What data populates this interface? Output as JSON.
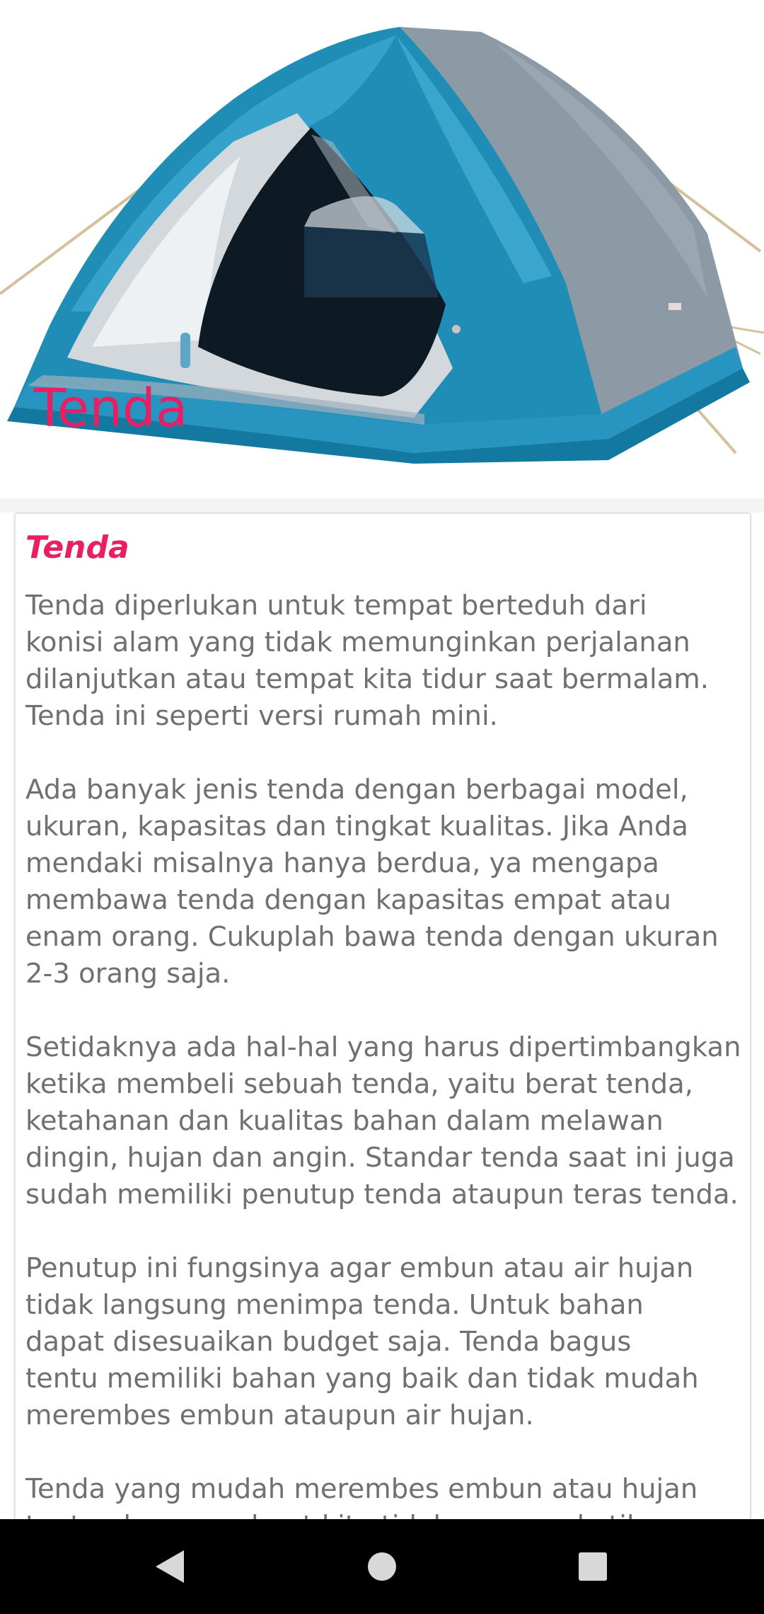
{
  "header": {
    "title": "Tenda",
    "image_icon": "tent-image"
  },
  "card": {
    "title": "Tenda",
    "paragraphs": [
      "Tenda diperlukan untuk tempat berteduh dari\nkonisi alam yang tidak memunginkan perjalanan\ndilanjutkan atau tempat kita tidur saat bermalam.\nTenda ini seperti versi rumah mini.",
      "Ada banyak jenis tenda dengan berbagai model,\nukuran, kapasitas dan tingkat kualitas. Jika Anda\nmendaki misalnya hanya berdua, ya mengapa\nmembawa tenda dengan kapasitas empat atau\nenam orang. Cukuplah bawa tenda dengan ukuran\n2-3 orang saja.",
      "Setidaknya ada hal-hal yang harus dipertimbangkan\nketika membeli sebuah tenda, yaitu berat tenda,\nketahanan dan kualitas bahan dalam melawan\ndingin, hujan dan angin. Standar tenda saat ini juga\nsudah memiliki penutup tenda ataupun teras tenda.",
      "Penutup ini fungsinya agar embun atau air hujan\ntidak langsung menimpa tenda. Untuk bahan\ndapat disesuaikan budget saja. Tenda bagus\ntentu memiliki bahan yang baik dan tidak mudah\nmerembes embun ataupun air hujan.",
      "Tenda yang mudah merembes embun atau hujan\ntentu akan membuat kita tidak nyaman ketika"
    ]
  },
  "navigation": {
    "back_icon": "back-triangle-icon",
    "home_icon": "home-circle-icon",
    "recent_icon": "recent-square-icon"
  },
  "colors": {
    "accent": "#e91e63",
    "body_text": "#707070",
    "nav_bg": "#000000",
    "nav_icon": "#d8d8d8"
  }
}
